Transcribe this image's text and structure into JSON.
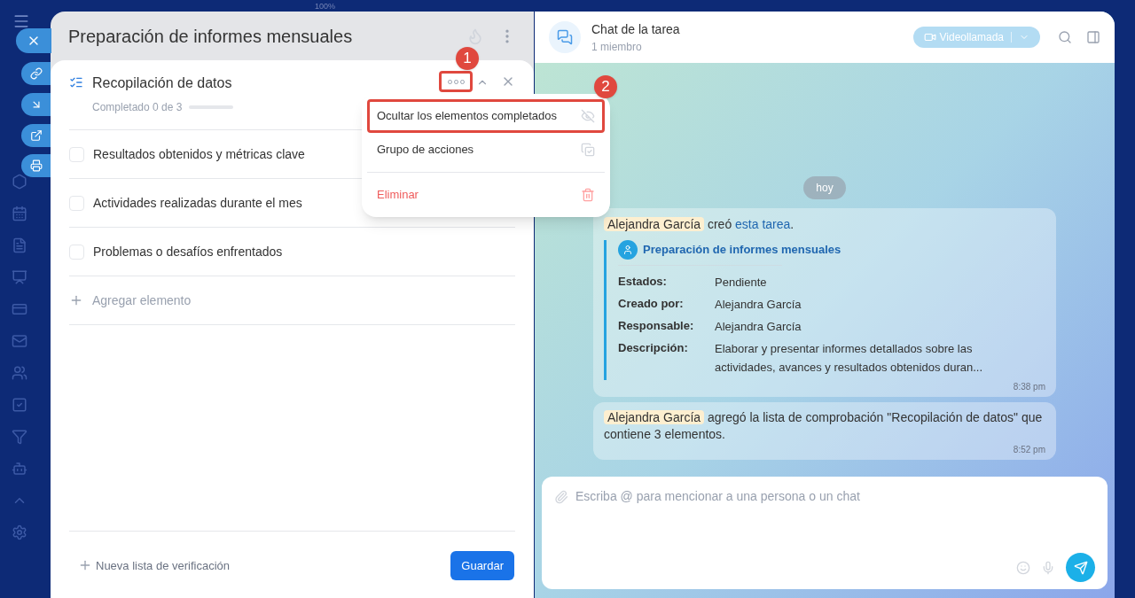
{
  "zoom_label": "100%",
  "task": {
    "title": "Preparación de informes mensuales",
    "checklist": {
      "title": "Recopilación de datos",
      "more_button_highlighted": true,
      "progress_text": "Completado 0 de 3",
      "level": 0,
      "items": [
        {
          "label": "Resultados obtenidos y métricas clave",
          "checked": false
        },
        {
          "label": "Actividades realizadas durante el mes",
          "checked": false
        },
        {
          "label": "Problemas o desafíos enfrentados",
          "checked": false
        }
      ],
      "add_item": "Agregar elemento"
    },
    "new_checklist": "Nueva lista de verificación",
    "save": "Guardar"
  },
  "menu": {
    "items": [
      {
        "label": "Ocultar los elementos completados",
        "kind": "normal",
        "highlighted": true
      },
      {
        "label": "Grupo de acciones",
        "kind": "normal",
        "highlighted": false
      },
      {
        "label": "Eliminar",
        "kind": "danger",
        "highlighted": false
      }
    ]
  },
  "callouts": [
    {
      "number": "1"
    },
    {
      "number": "2"
    }
  ],
  "chat": {
    "title": "Chat de la tarea",
    "subtitle": "1 miembro",
    "video_button": "Videollamada",
    "date": "hoy",
    "messages": [
      {
        "kind": "task_card",
        "author": "Alejandra García",
        "text": "creó",
        "link": "esta tarea",
        "suffix": ".",
        "card_title": "Preparación de informes mensuales",
        "fields": [
          {
            "label": "Estados:",
            "value": "Pendiente"
          },
          {
            "label": "Creado por:",
            "value": "Alejandra García"
          },
          {
            "label": "Responsable:",
            "value": "Alejandra García"
          },
          {
            "label": "Descripción:",
            "value": "Elaborar y presentar informes detallados sobre las actividades, avances y resultados obtenidos duran..."
          }
        ],
        "time": "8:38 pm"
      },
      {
        "kind": "text",
        "author": "Alejandra García",
        "text": "agregó la lista de comprobación \"Recopilación de datos\" que contiene 3 elementos.",
        "time": "8:52 pm"
      }
    ],
    "input": {
      "placeholder": "Escriba @ para mencionar a una persona o un chat"
    }
  }
}
